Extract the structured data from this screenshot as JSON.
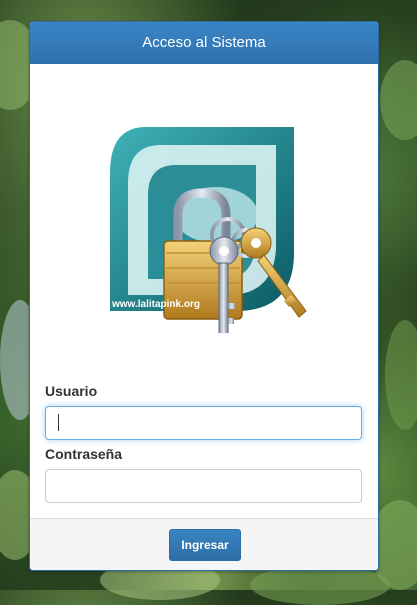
{
  "panel": {
    "title": "Acceso al Sistema"
  },
  "logo": {
    "icon": "padlock-keys-icon",
    "watermark_text": "www.lalitapink.org"
  },
  "form": {
    "username_label": "Usuario",
    "username_value": "",
    "password_label": "Contraseña",
    "password_value": "",
    "submit_label": "Ingresar"
  },
  "colors": {
    "accent": "#337ab7",
    "focus": "#66afe9"
  }
}
